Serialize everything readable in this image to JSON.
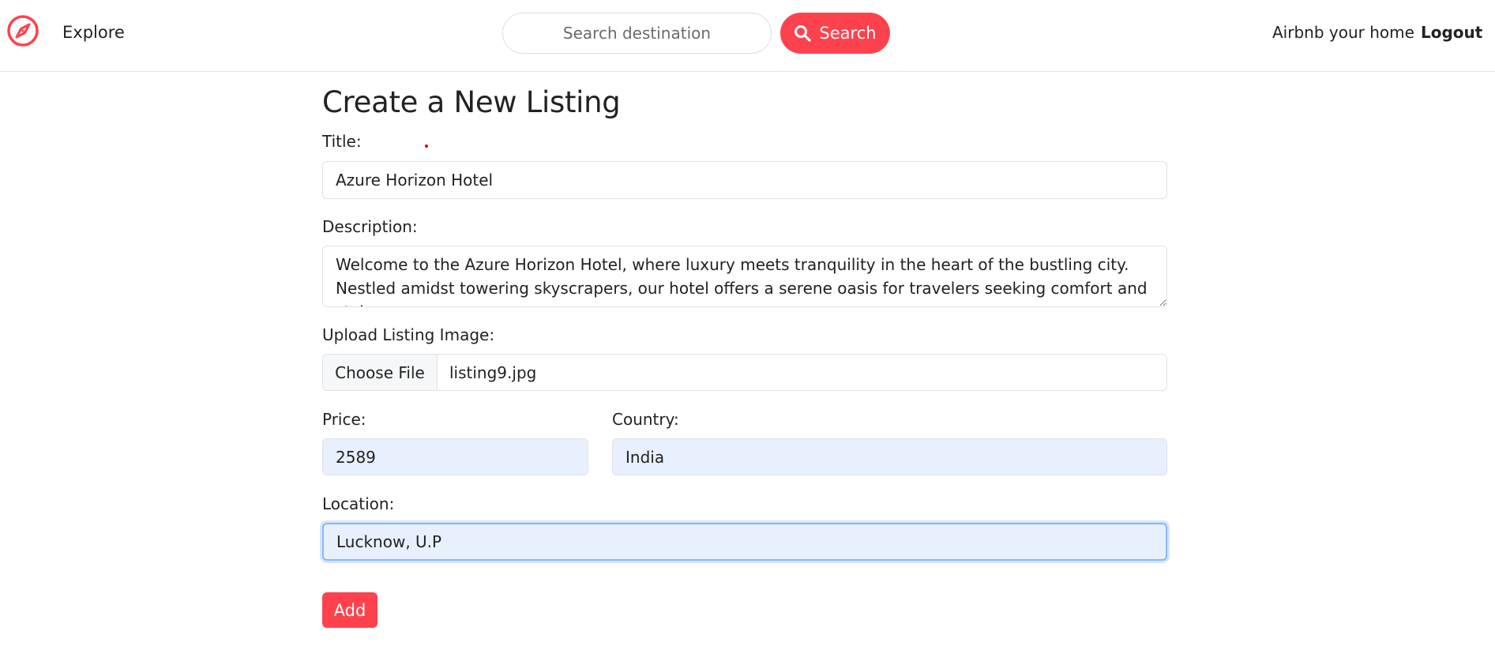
{
  "navbar": {
    "logo_icon": "compass-icon",
    "explore_label": "Explore",
    "search_placeholder": "Search destination",
    "search_button_label": "Search",
    "search_icon": "search-icon",
    "host_label": "Airbnb your home",
    "logout_label": "Logout"
  },
  "form": {
    "title": "Create a New Listing",
    "fields": {
      "title_label": "Title:",
      "title_value": "Azure Horizon Hotel",
      "description_label": "Description:",
      "description_value": "Welcome to the Azure Horizon Hotel, where luxury meets tranquility in the heart of the bustling city. Nestled amidst towering skyscrapers, our hotel offers a serene oasis for travelers seeking comfort and style.",
      "image_label": "Upload Listing Image:",
      "file_button_label": "Choose File",
      "file_name": "listing9.jpg",
      "price_label": "Price:",
      "price_value": "2589",
      "country_label": "Country:",
      "country_value": "India",
      "location_label": "Location:",
      "location_value": "Lucknow, U.P"
    },
    "submit_label": "Add"
  },
  "colors": {
    "brand": "#fe424d",
    "autofill_bg": "#e8f0fe",
    "focus_border": "#86b7fe"
  }
}
